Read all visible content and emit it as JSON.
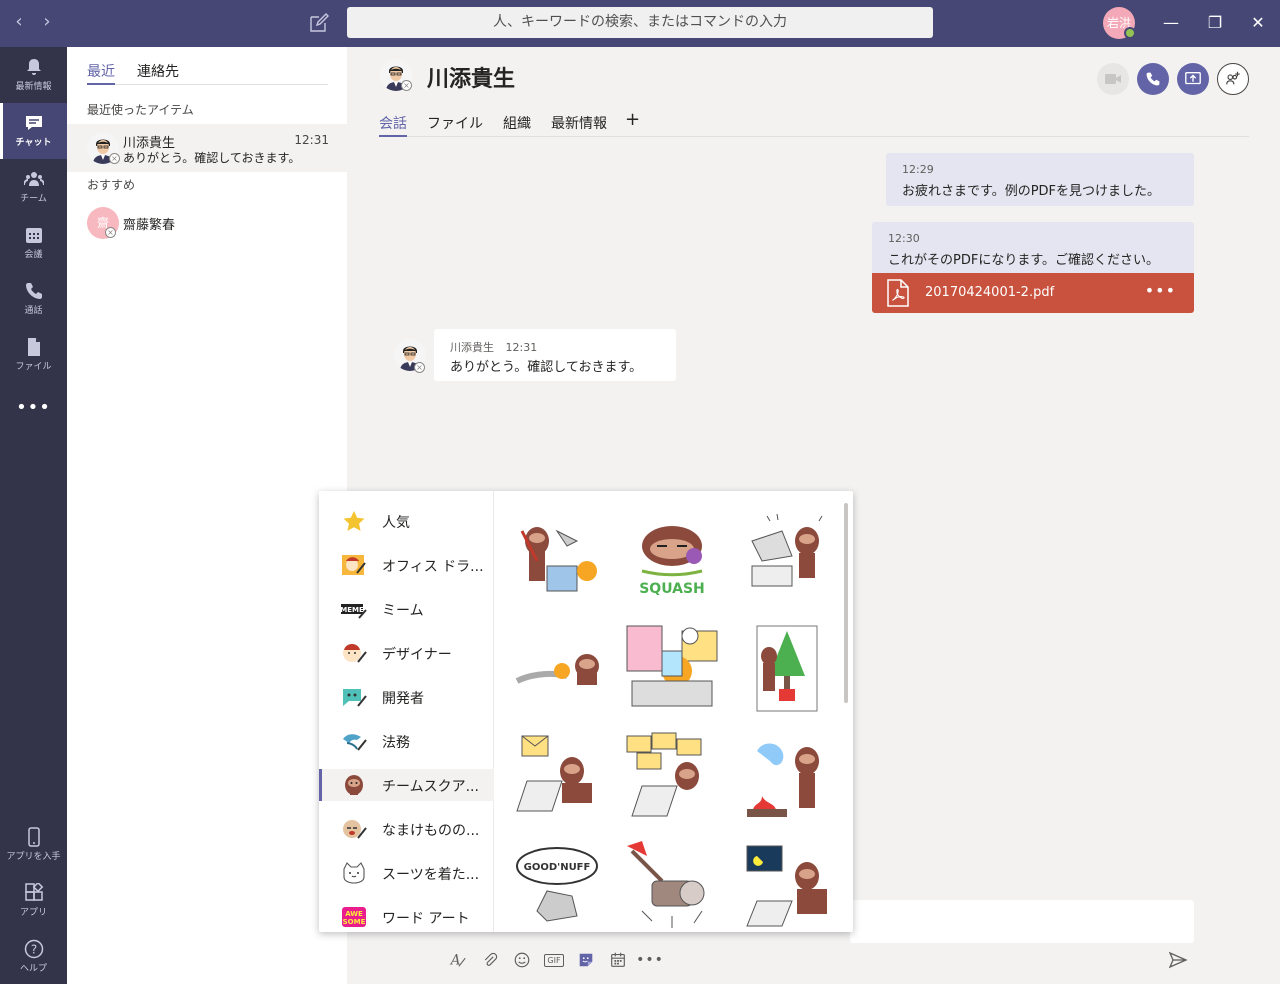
{
  "titlebar": {
    "search_placeholder": "人、キーワードの検索、またはコマンドの入力",
    "user_initials": "岩洪"
  },
  "rail": {
    "items": [
      {
        "label": "最新情報",
        "icon": "bell-icon"
      },
      {
        "label": "チャット",
        "icon": "chat-icon"
      },
      {
        "label": "チーム",
        "icon": "teams-icon"
      },
      {
        "label": "会議",
        "icon": "calendar-icon"
      },
      {
        "label": "通話",
        "icon": "phone-icon"
      },
      {
        "label": "ファイル",
        "icon": "file-icon"
      }
    ],
    "more": "•••",
    "bottom": [
      {
        "label": "アプリを入手",
        "icon": "mobile-icon"
      },
      {
        "label": "アプリ",
        "icon": "apps-icon"
      },
      {
        "label": "ヘルプ",
        "icon": "help-icon"
      }
    ]
  },
  "chatlist": {
    "tabs": [
      "最近",
      "連絡先"
    ],
    "recent_label": "最近使ったアイテム",
    "recommend_label": "おすすめ",
    "recent": {
      "name": "川添貴生",
      "time": "12:31",
      "preview": "ありがとう。確認しておきます。"
    },
    "suggested": {
      "name": "齋藤繁春",
      "avatar_text": "齋"
    }
  },
  "conversation": {
    "title": "川添貴生",
    "tabs": [
      "会話",
      "ファイル",
      "組織",
      "最新情報"
    ],
    "add_tab": "+",
    "messages": [
      {
        "time": "12:29",
        "text": "お疲れさまです。例のPDFを見つけました。"
      },
      {
        "time": "12:30",
        "text": "これがそのPDFになります。ご確認ください。"
      },
      {
        "sender": "川添貴生",
        "time": "12:31",
        "text": "ありがとう。確認しておきます。"
      }
    ],
    "file": {
      "name": "20170424001-2.pdf",
      "more": "•••"
    }
  },
  "stickers": {
    "categories": [
      "人気",
      "オフィス ドラ...",
      "ミーム",
      "デザイナー",
      "開発者",
      "法務",
      "チームスクア...",
      "なまけものの...",
      "スーツを着た...",
      "ワード アート"
    ],
    "active_index": 6,
    "text_stickers": {
      "squash": "SQUASH",
      "goodnuff": "GOOD'NUFF"
    }
  },
  "composer": {
    "tools": [
      "format-icon",
      "attach-icon",
      "emoji-icon",
      "gif-icon",
      "sticker-icon",
      "meeting-icon",
      "more-icon"
    ],
    "gif_label": "GIF",
    "more_label": "•••"
  },
  "colors": {
    "brand": "#6264a7",
    "titlebar": "#464775",
    "rail": "#33344a",
    "pdf": "#c8523d"
  }
}
